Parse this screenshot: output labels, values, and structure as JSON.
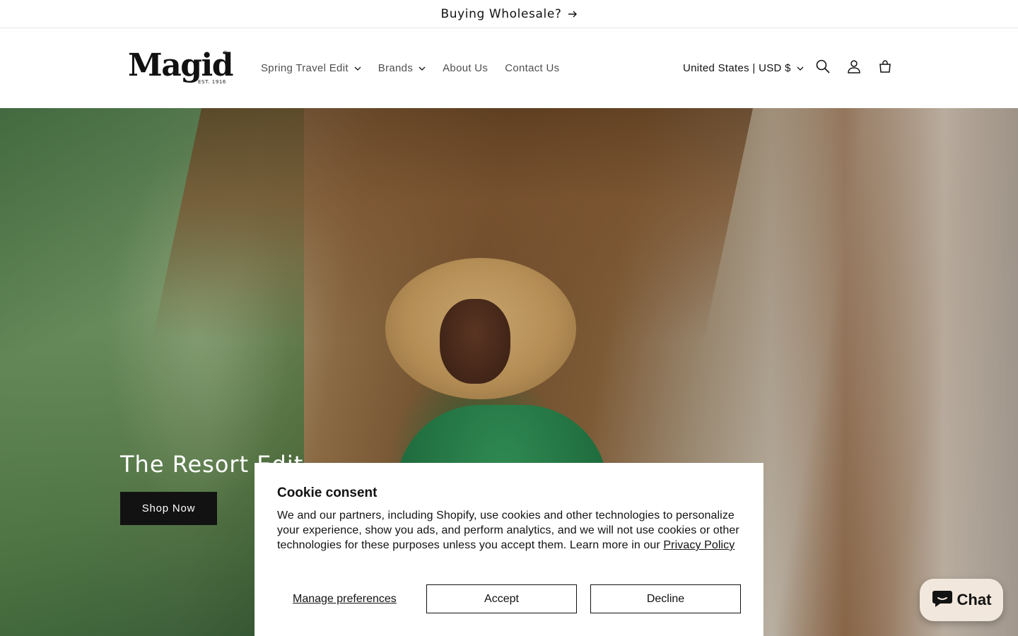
{
  "announcement": {
    "text": "Buying Wholesale?",
    "arrow_icon": "arrow-right-icon"
  },
  "header": {
    "logo": {
      "word": "Magid",
      "est": "EST. 1916",
      "reg": "®"
    },
    "nav": [
      {
        "label": "Spring Travel Edit",
        "has_dropdown": true
      },
      {
        "label": "Brands",
        "has_dropdown": true
      },
      {
        "label": "About Us",
        "has_dropdown": false
      },
      {
        "label": "Contact Us",
        "has_dropdown": false
      }
    ],
    "currency": "United States | USD $",
    "icons": [
      "search-icon",
      "account-icon",
      "cart-icon"
    ]
  },
  "hero": {
    "title": "The Resort Edit",
    "button_label": "Shop Now"
  },
  "cookie": {
    "title": "Cookie consent",
    "body": "We and our partners, including Shopify, use cookies and other technologies to personalize your experience, show you ads, and perform analytics, and we will not use cookies or other technologies for these purposes unless you accept them. Learn more in our ",
    "link": "Privacy Policy",
    "manage_label": "Manage preferences",
    "accept_label": "Accept",
    "decline_label": "Decline"
  },
  "chat": {
    "label": "Chat",
    "icon": "chat-bubble-icon",
    "bg": "#f2e7dc"
  }
}
